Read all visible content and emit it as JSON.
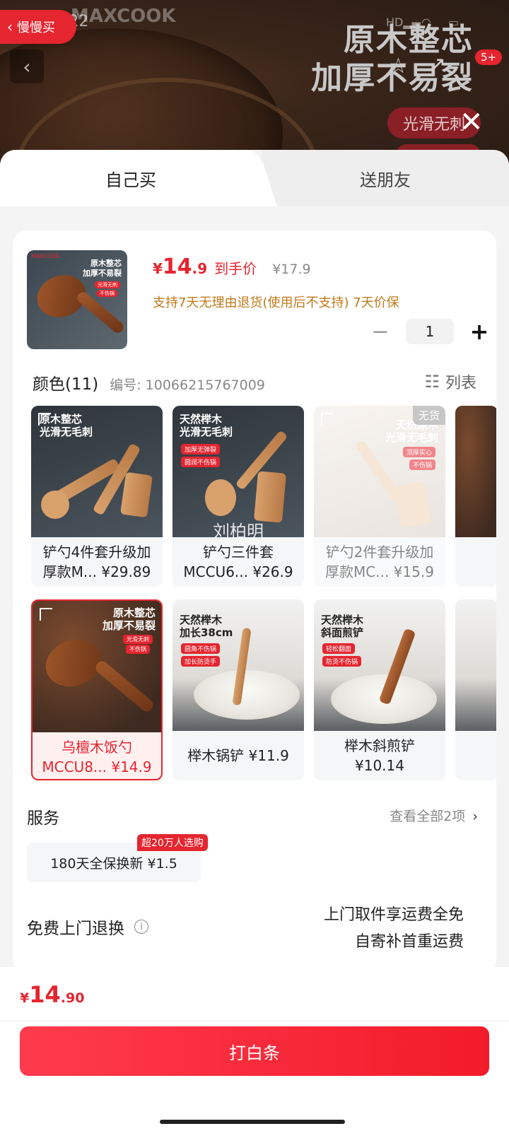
{
  "overlay": {
    "back_pill": "慢慢买",
    "status_time": "12:22",
    "brand_wm": "MAXCOOK",
    "headline_1": "原木整芯",
    "headline_2": "加厚不易裂",
    "tag": "光滑无刺",
    "badge": "5+"
  },
  "tabs": {
    "mine": "自己买",
    "friend": "送朋友"
  },
  "product": {
    "price_yen": "¥",
    "price_int": "14",
    "price_dec": ".9",
    "price_tag": "到手价",
    "price_old": "¥17.9",
    "promise": "支持7天无理由退货(使用后不支持) 7天价保",
    "thumb_text_1": "原木整芯",
    "thumb_text_2": "加厚不易裂",
    "thumb_tag_1": "光滑无刺",
    "thumb_tag_2": "不伤锅",
    "brand": "MAXCOOK",
    "quantity": "1"
  },
  "color_section": {
    "title": "颜色(11)",
    "sku": "编号: 10066215767009",
    "list_toggle": "列表"
  },
  "options": [
    {
      "label": "铲勺4件套升级加厚款M...  ¥29.89",
      "img_text_1": "原木整芯",
      "img_text_2": "光滑无毛刺",
      "state": "normal"
    },
    {
      "label": "铲勺三件套MCCU6...  ¥26.9",
      "img_text_1": "天然榉木",
      "img_text_2": "光滑无毛刺",
      "img_tag_1": "加厚无弹裂",
      "img_tag_2": "圆润不伤锅",
      "watermark": "刘柏明",
      "state": "normal"
    },
    {
      "label": "铲勺2件套升级加厚款MC...  ¥15.9",
      "img_text_1": "天然原木",
      "img_text_2": "光滑无毛刺",
      "img_tag_1": "顶厚实心",
      "img_tag_2": "不伤锅",
      "no_stock": "无货",
      "state": "unavailable"
    },
    {
      "label": "乌檀木饭勺MCCU8...  ¥14.9",
      "img_text_1": "原木整芯",
      "img_text_2": "加厚不易裂",
      "img_tag_1": "光滑无刺",
      "img_tag_2": "不伤锅",
      "state": "selected"
    },
    {
      "label": "榉木锅铲  ¥11.9",
      "img_text_1": "天然榉木",
      "img_text_2": "加长38cm",
      "img_tag_1": "圆角不伤锅",
      "img_tag_2": "加长防烫手",
      "state": "normal"
    },
    {
      "label": "榉木斜煎铲 ¥10.14",
      "img_text_1": "天然榉木",
      "img_text_2": "斜面煎铲",
      "img_tag_1": "轻松翻面",
      "img_tag_2": "防烫不伤锅",
      "state": "normal"
    }
  ],
  "services": {
    "title": "服务",
    "view_all": "查看全部2项",
    "chip": "180天全保换新  ¥1.5",
    "chip_hot": "超20万人选购"
  },
  "return": {
    "title": "免费上门退换",
    "line1": "上门取件享运费全免",
    "line2": "自寄补首重运费"
  },
  "footer": {
    "total_yen": "¥",
    "total_int": "14",
    "total_dec": ".90",
    "pay_button": "打白条"
  },
  "colors": {
    "accent": "#e5252f",
    "promise": "#c07a1a"
  },
  "icons": [
    "chevron-left-icon",
    "star-icon",
    "share-icon",
    "close-icon",
    "minus-icon",
    "plus-icon",
    "list-icon",
    "chevron-right-icon",
    "info-icon",
    "expand-icon"
  ]
}
